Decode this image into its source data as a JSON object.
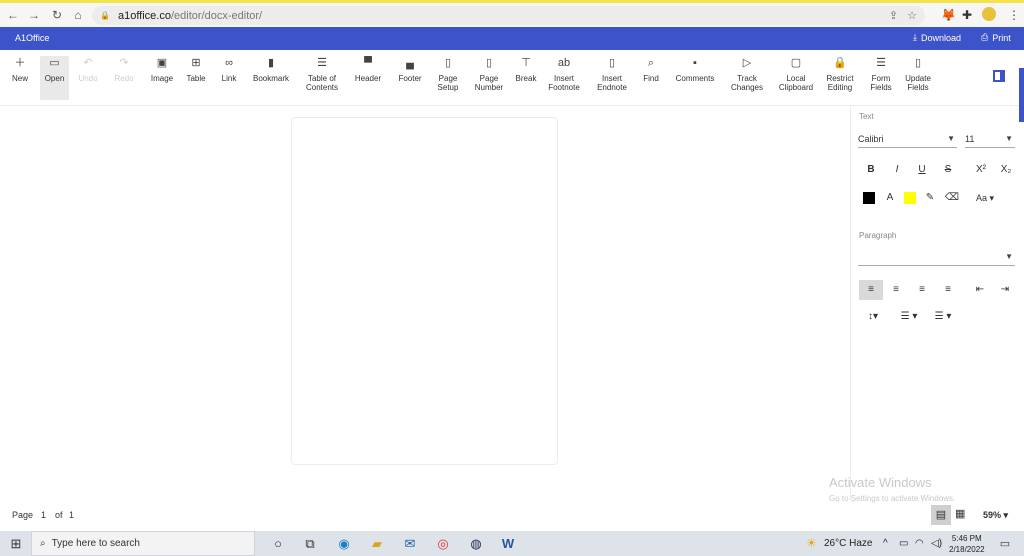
{
  "browser": {
    "host": "a1office.co",
    "path": "/editor/docx-editor/"
  },
  "app": {
    "title": "A1Office",
    "download_label": "Download",
    "print_label": "Print"
  },
  "toolbar": {
    "tools": [
      {
        "label": "New",
        "icon": "plus-icon"
      },
      {
        "label": "Open",
        "icon": "folder-icon",
        "active": true
      },
      {
        "label": "Undo",
        "icon": "undo-icon",
        "disabled": true
      },
      {
        "label": "Redo",
        "icon": "redo-icon",
        "disabled": true
      },
      {
        "label": "Image",
        "icon": "image-icon"
      },
      {
        "label": "Table",
        "icon": "table-icon"
      },
      {
        "label": "Link",
        "icon": "link-icon"
      },
      {
        "label": "Bookmark",
        "icon": "bookmark-icon"
      },
      {
        "label": "Table of Contents",
        "icon": "toc-icon"
      },
      {
        "label": "Header",
        "icon": "header-icon"
      },
      {
        "label": "Footer",
        "icon": "footer-icon"
      },
      {
        "label": "Page Setup",
        "icon": "page-setup-icon"
      },
      {
        "label": "Page Number",
        "icon": "page-number-icon"
      },
      {
        "label": "Break",
        "icon": "break-icon"
      },
      {
        "label": "Insert Footnote",
        "icon": "footnote-icon"
      },
      {
        "label": "Insert Endnote",
        "icon": "endnote-icon"
      },
      {
        "label": "Find",
        "icon": "search-icon"
      },
      {
        "label": "Comments",
        "icon": "comment-icon"
      },
      {
        "label": "Track Changes",
        "icon": "track-changes-icon"
      },
      {
        "label": "Local Clipboard",
        "icon": "clipboard-icon"
      },
      {
        "label": "Restrict Editing",
        "icon": "lock-icon"
      },
      {
        "label": "Form Fields",
        "icon": "form-fields-icon"
      },
      {
        "label": "Update Fields",
        "icon": "update-fields-icon"
      }
    ]
  },
  "pane": {
    "text_label": "Text",
    "font_family": "Calibri",
    "font_size": "11",
    "bold": "B",
    "italic": "I",
    "underline": "U",
    "strike": "S",
    "superscript": "X²",
    "subscript": "X₂",
    "font_color_label": "A",
    "change_case": "Aa",
    "paragraph_label": "Paragraph",
    "colors": {
      "font": "#000000",
      "highlight": "#ffff00",
      "accent": "#3d53c9"
    }
  },
  "status": {
    "page_label": "Page",
    "current_page": "1",
    "of_label": "of",
    "total_pages": "1",
    "zoom": "59%"
  },
  "watermark": {
    "title": "Activate Windows",
    "subtitle": "Go to Settings to activate Windows."
  },
  "taskbar": {
    "search_placeholder": "Type here to search",
    "weather": "26°C  Haze",
    "time": "5:46 PM",
    "date": "2/18/2022"
  }
}
